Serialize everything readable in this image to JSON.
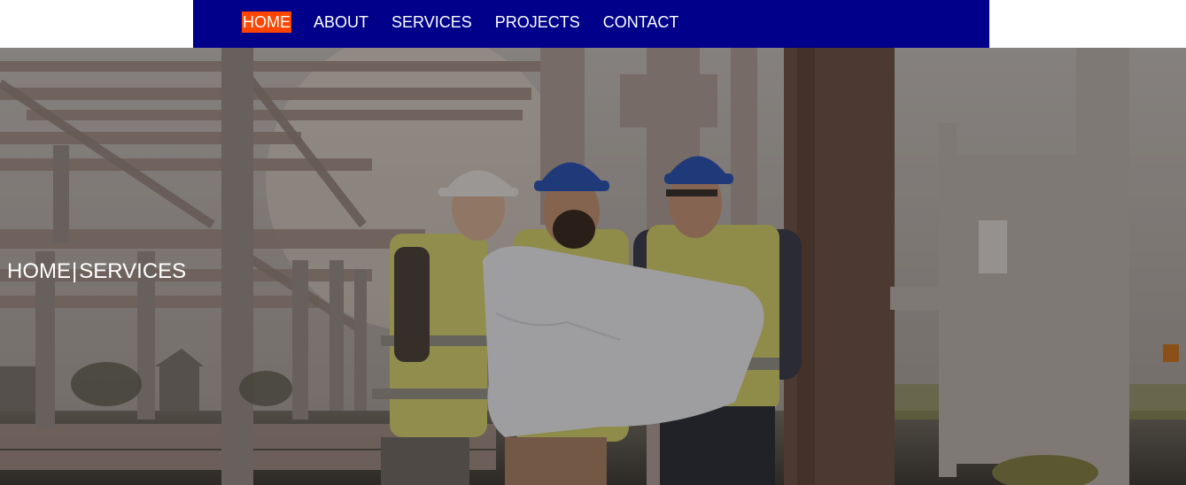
{
  "nav": {
    "items": [
      {
        "label": "HOME",
        "active": true
      },
      {
        "label": "ABOUT",
        "active": false
      },
      {
        "label": "SERVICES",
        "active": false
      },
      {
        "label": "PROJECTS",
        "active": false
      },
      {
        "label": "CONTACT",
        "active": false
      }
    ],
    "colors": {
      "bar": "#00008b",
      "active_bg": "#ff4500",
      "text": "#ffffff"
    }
  },
  "hero": {
    "breadcrumb": {
      "home": "HOME",
      "separator": "|",
      "current": "SERVICES"
    },
    "image_subject": "construction-workers-reviewing-blueprint-photo"
  }
}
